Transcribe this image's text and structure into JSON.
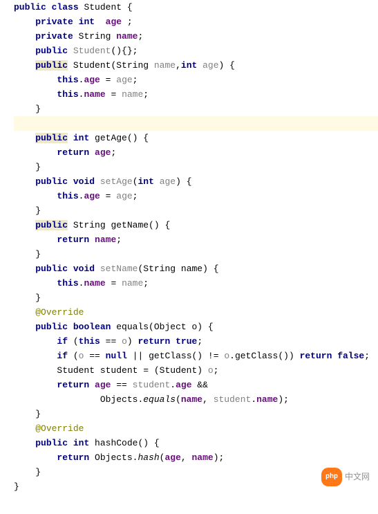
{
  "code": {
    "l1_kw1": "public",
    "l1_kw2": "class",
    "l1_name": "Student",
    "l1_brace": " {",
    "l2_kw1": "private",
    "l2_kw2": "int",
    "l2_field": "age",
    "l2_end": " ;",
    "l3_kw1": "private",
    "l3_type": "String ",
    "l3_field": "name",
    "l3_end": ";",
    "l4_kw1": "public",
    "l4_ctor": "Student",
    "l4_end": "(){};",
    "l5_kw1": "public",
    "l5_ctor": " Student(String ",
    "l5_p1": "name",
    "l5_comma": ",",
    "l5_kw2": "int",
    "l5_p2": " age",
    "l5_end": ") {",
    "l6_kw": "this",
    "l6_dot": ".",
    "l6_field": "age",
    "l6_eq": " = ",
    "l6_var": "age",
    "l6_end": ";",
    "l7_kw": "this",
    "l7_dot": ".",
    "l7_field": "name",
    "l7_eq": " = ",
    "l7_var": "name",
    "l7_end": ";",
    "l8_brace": "}",
    "l10_kw1": "public",
    "l10_sp": " ",
    "l10_kw2": "int",
    "l10_m": " getAge() {",
    "l11_kw": "return",
    "l11_sp": " ",
    "l11_field": "age",
    "l11_end": ";",
    "l12_brace": "}",
    "l13_kw1": "public",
    "l13_kw2": "void",
    "l13_m": "setAge",
    "l13_open": "(",
    "l13_kw3": "int",
    "l13_p": " age",
    "l13_end": ") {",
    "l14_kw": "this",
    "l14_dot": ".",
    "l14_field": "age",
    "l14_eq": " = ",
    "l14_var": "age",
    "l14_end": ";",
    "l15_brace": "}",
    "l16_kw1": "public",
    "l16_type": " String getName() {",
    "l17_kw": "return",
    "l17_sp": " ",
    "l17_field": "name",
    "l17_end": ";",
    "l18_brace": "}",
    "l19_kw1": "public",
    "l19_kw2": "void",
    "l19_m": "setName",
    "l19_p": "(String name) {",
    "l20_kw": "this",
    "l20_dot": ".",
    "l20_field": "name",
    "l20_eq": " = ",
    "l20_var": "name",
    "l20_end": ";",
    "l21_brace": "}",
    "l22_anno": "@Override",
    "l23_kw1": "public",
    "l23_kw2": "boolean",
    "l23_m": " equals(Object o) {",
    "l24_kw1": "if",
    "l24_open": " (",
    "l24_kw2": "this",
    "l24_eq": " == ",
    "l24_var": "o",
    "l24_close": ") ",
    "l24_kw3": "return",
    "l24_sp": " ",
    "l24_kw4": "true",
    "l24_end": ";",
    "l25_kw1": "if",
    "l25_open": " (",
    "l25_var1": "o",
    "l25_eq": " == ",
    "l25_kw2": "null",
    "l25_or": " || getClass() != ",
    "l25_var2": "o",
    "l25_call": ".getClass()) ",
    "l25_kw3": "return",
    "l25_sp": " ",
    "l25_kw4": "false",
    "l25_end": ";",
    "l26_txt": "Student student = (Student) ",
    "l26_var": "o",
    "l26_end": ";",
    "l27_kw": "return",
    "l27_sp": " ",
    "l27_f1": "age",
    "l27_eq": " == ",
    "l27_var1": "student",
    "l27_dot1": ".",
    "l27_f2": "age",
    "l27_and": " &&",
    "l28_pad": "        Objects.",
    "l28_m": "equals",
    "l28_open": "(",
    "l28_f1": "name",
    "l28_comma": ", ",
    "l28_var": "student",
    "l28_dot": ".",
    "l28_f2": "name",
    "l28_end": ");",
    "l29_brace": "}",
    "l30_anno": "@Override",
    "l31_kw1": "public",
    "l31_kw2": "int",
    "l31_m": " hashCode() {",
    "l32_kw": "return",
    "l32_txt": " Objects.",
    "l32_m": "hash",
    "l32_open": "(",
    "l32_f1": "age",
    "l32_comma": ", ",
    "l32_f2": "name",
    "l32_end": ");",
    "l33_brace": "}",
    "l34_brace": "}"
  },
  "watermark": {
    "icon": "php",
    "text": "中文网"
  }
}
